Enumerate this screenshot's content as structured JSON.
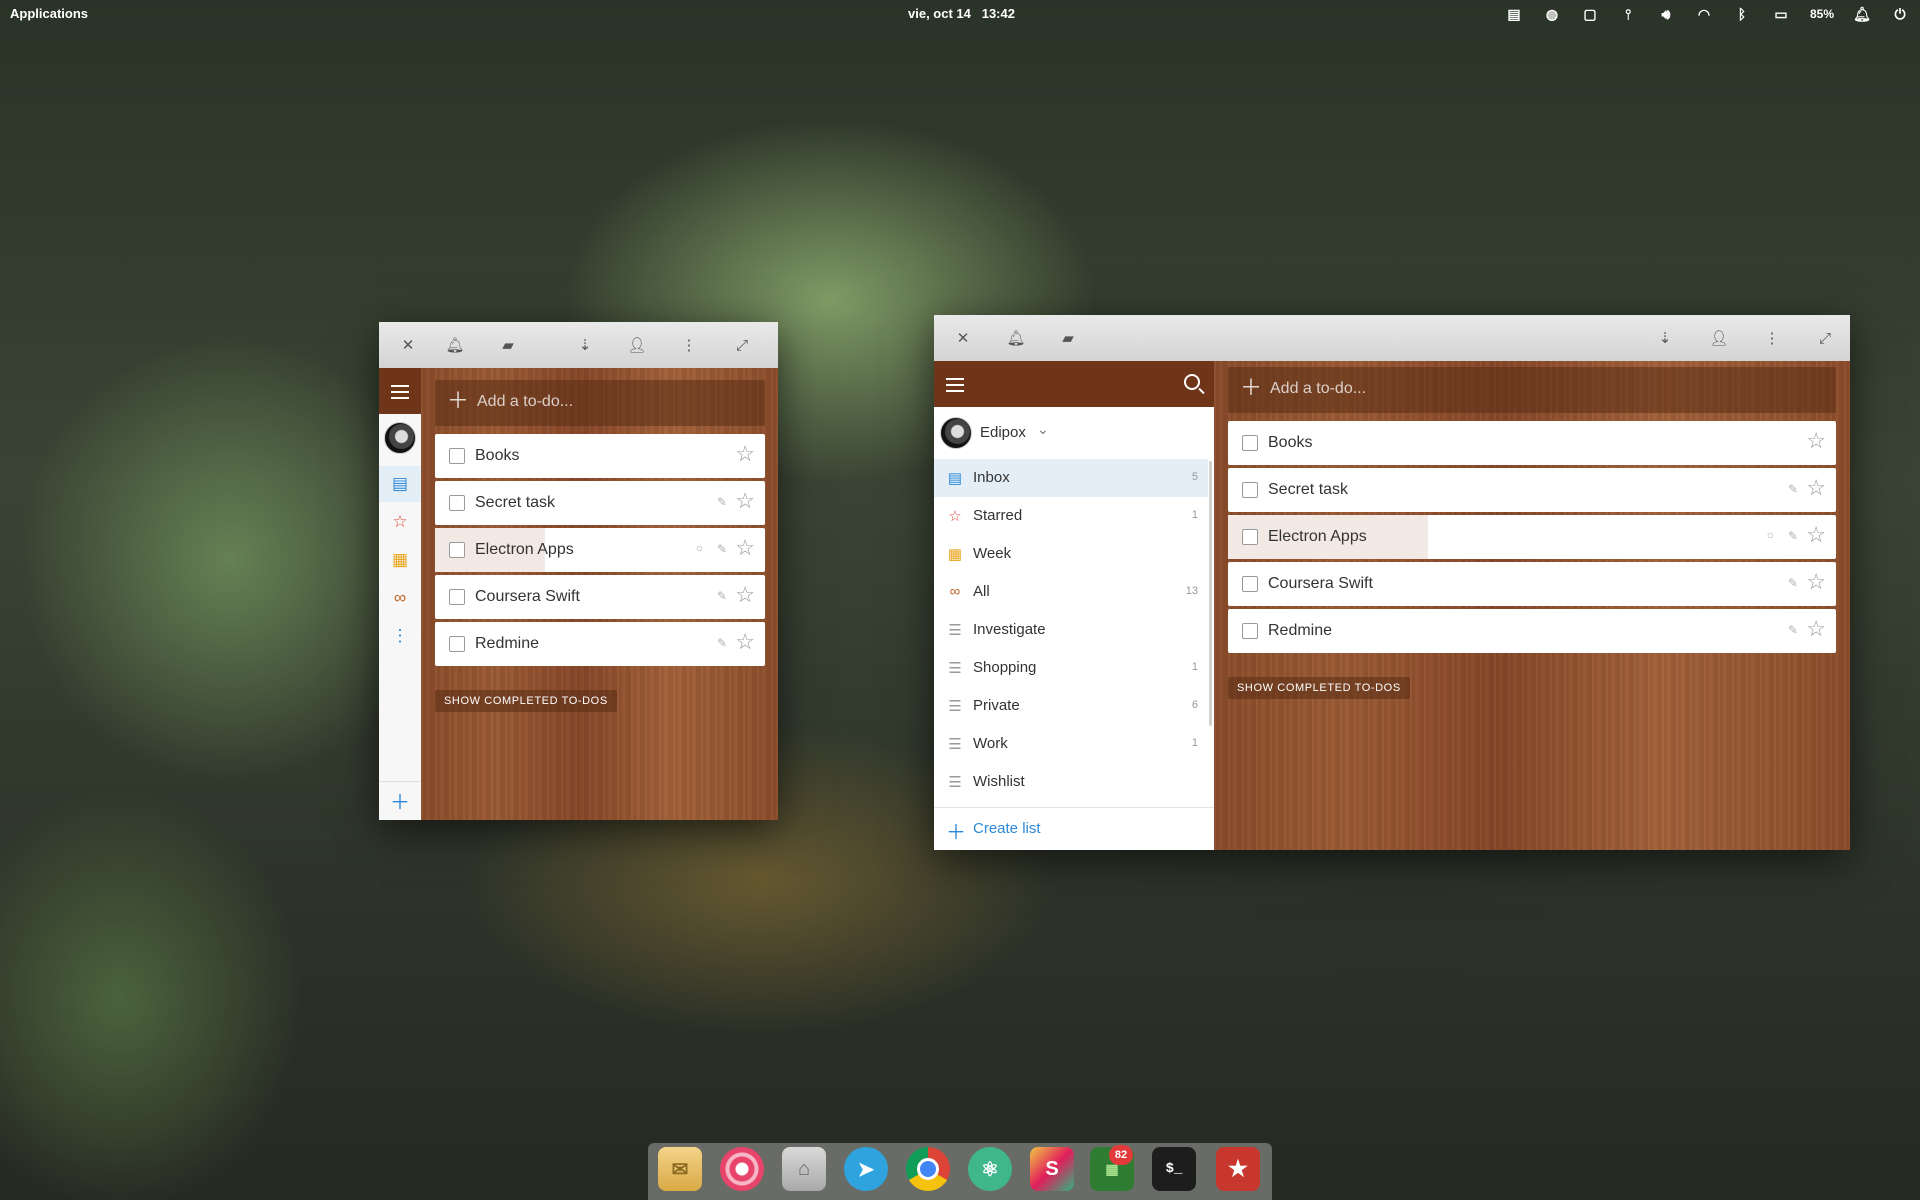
{
  "panel": {
    "applications": "Applications",
    "date": "vie, oct 14",
    "time": "13:42",
    "battery": "85%"
  },
  "small_window": {
    "add_placeholder": "Add a to-do...",
    "tasks": [
      {
        "label": "Books"
      },
      {
        "label": "Secret task"
      },
      {
        "label": "Electron Apps"
      },
      {
        "label": "Coursera Swift"
      },
      {
        "label": "Redmine"
      }
    ],
    "show_completed": "SHOW COMPLETED TO-DOS"
  },
  "large_window": {
    "user": "Edipox",
    "lists": [
      {
        "name": "Inbox",
        "count": "5",
        "icon": "inbox-icon"
      },
      {
        "name": "Starred",
        "count": "1",
        "icon": "star-icon"
      },
      {
        "name": "Week",
        "count": "",
        "icon": "calendar-icon"
      },
      {
        "name": "All",
        "count": "13",
        "icon": "infinity-icon"
      },
      {
        "name": "Investigate",
        "count": "",
        "icon": "list-icon"
      },
      {
        "name": "Shopping",
        "count": "1",
        "icon": "list-icon"
      },
      {
        "name": "Private",
        "count": "6",
        "icon": "list-icon"
      },
      {
        "name": "Work",
        "count": "1",
        "icon": "list-icon"
      },
      {
        "name": "Wishlist",
        "count": "",
        "icon": "list-icon"
      }
    ],
    "create_list": "Create list",
    "add_placeholder": "Add a to-do...",
    "tasks": [
      {
        "label": "Books"
      },
      {
        "label": "Secret task"
      },
      {
        "label": "Electron Apps"
      },
      {
        "label": "Coursera Swift"
      },
      {
        "label": "Redmine"
      }
    ],
    "show_completed": "SHOW COMPLETED TO-DOS"
  },
  "dock": {
    "telegram_badge": "82",
    "terminal_glyph": "$_"
  },
  "colors": {
    "accent_blue": "#2b88d9",
    "star_red": "#e0483b",
    "wood_brown": "#8a4c2a",
    "header_brown": "#6e3518"
  }
}
